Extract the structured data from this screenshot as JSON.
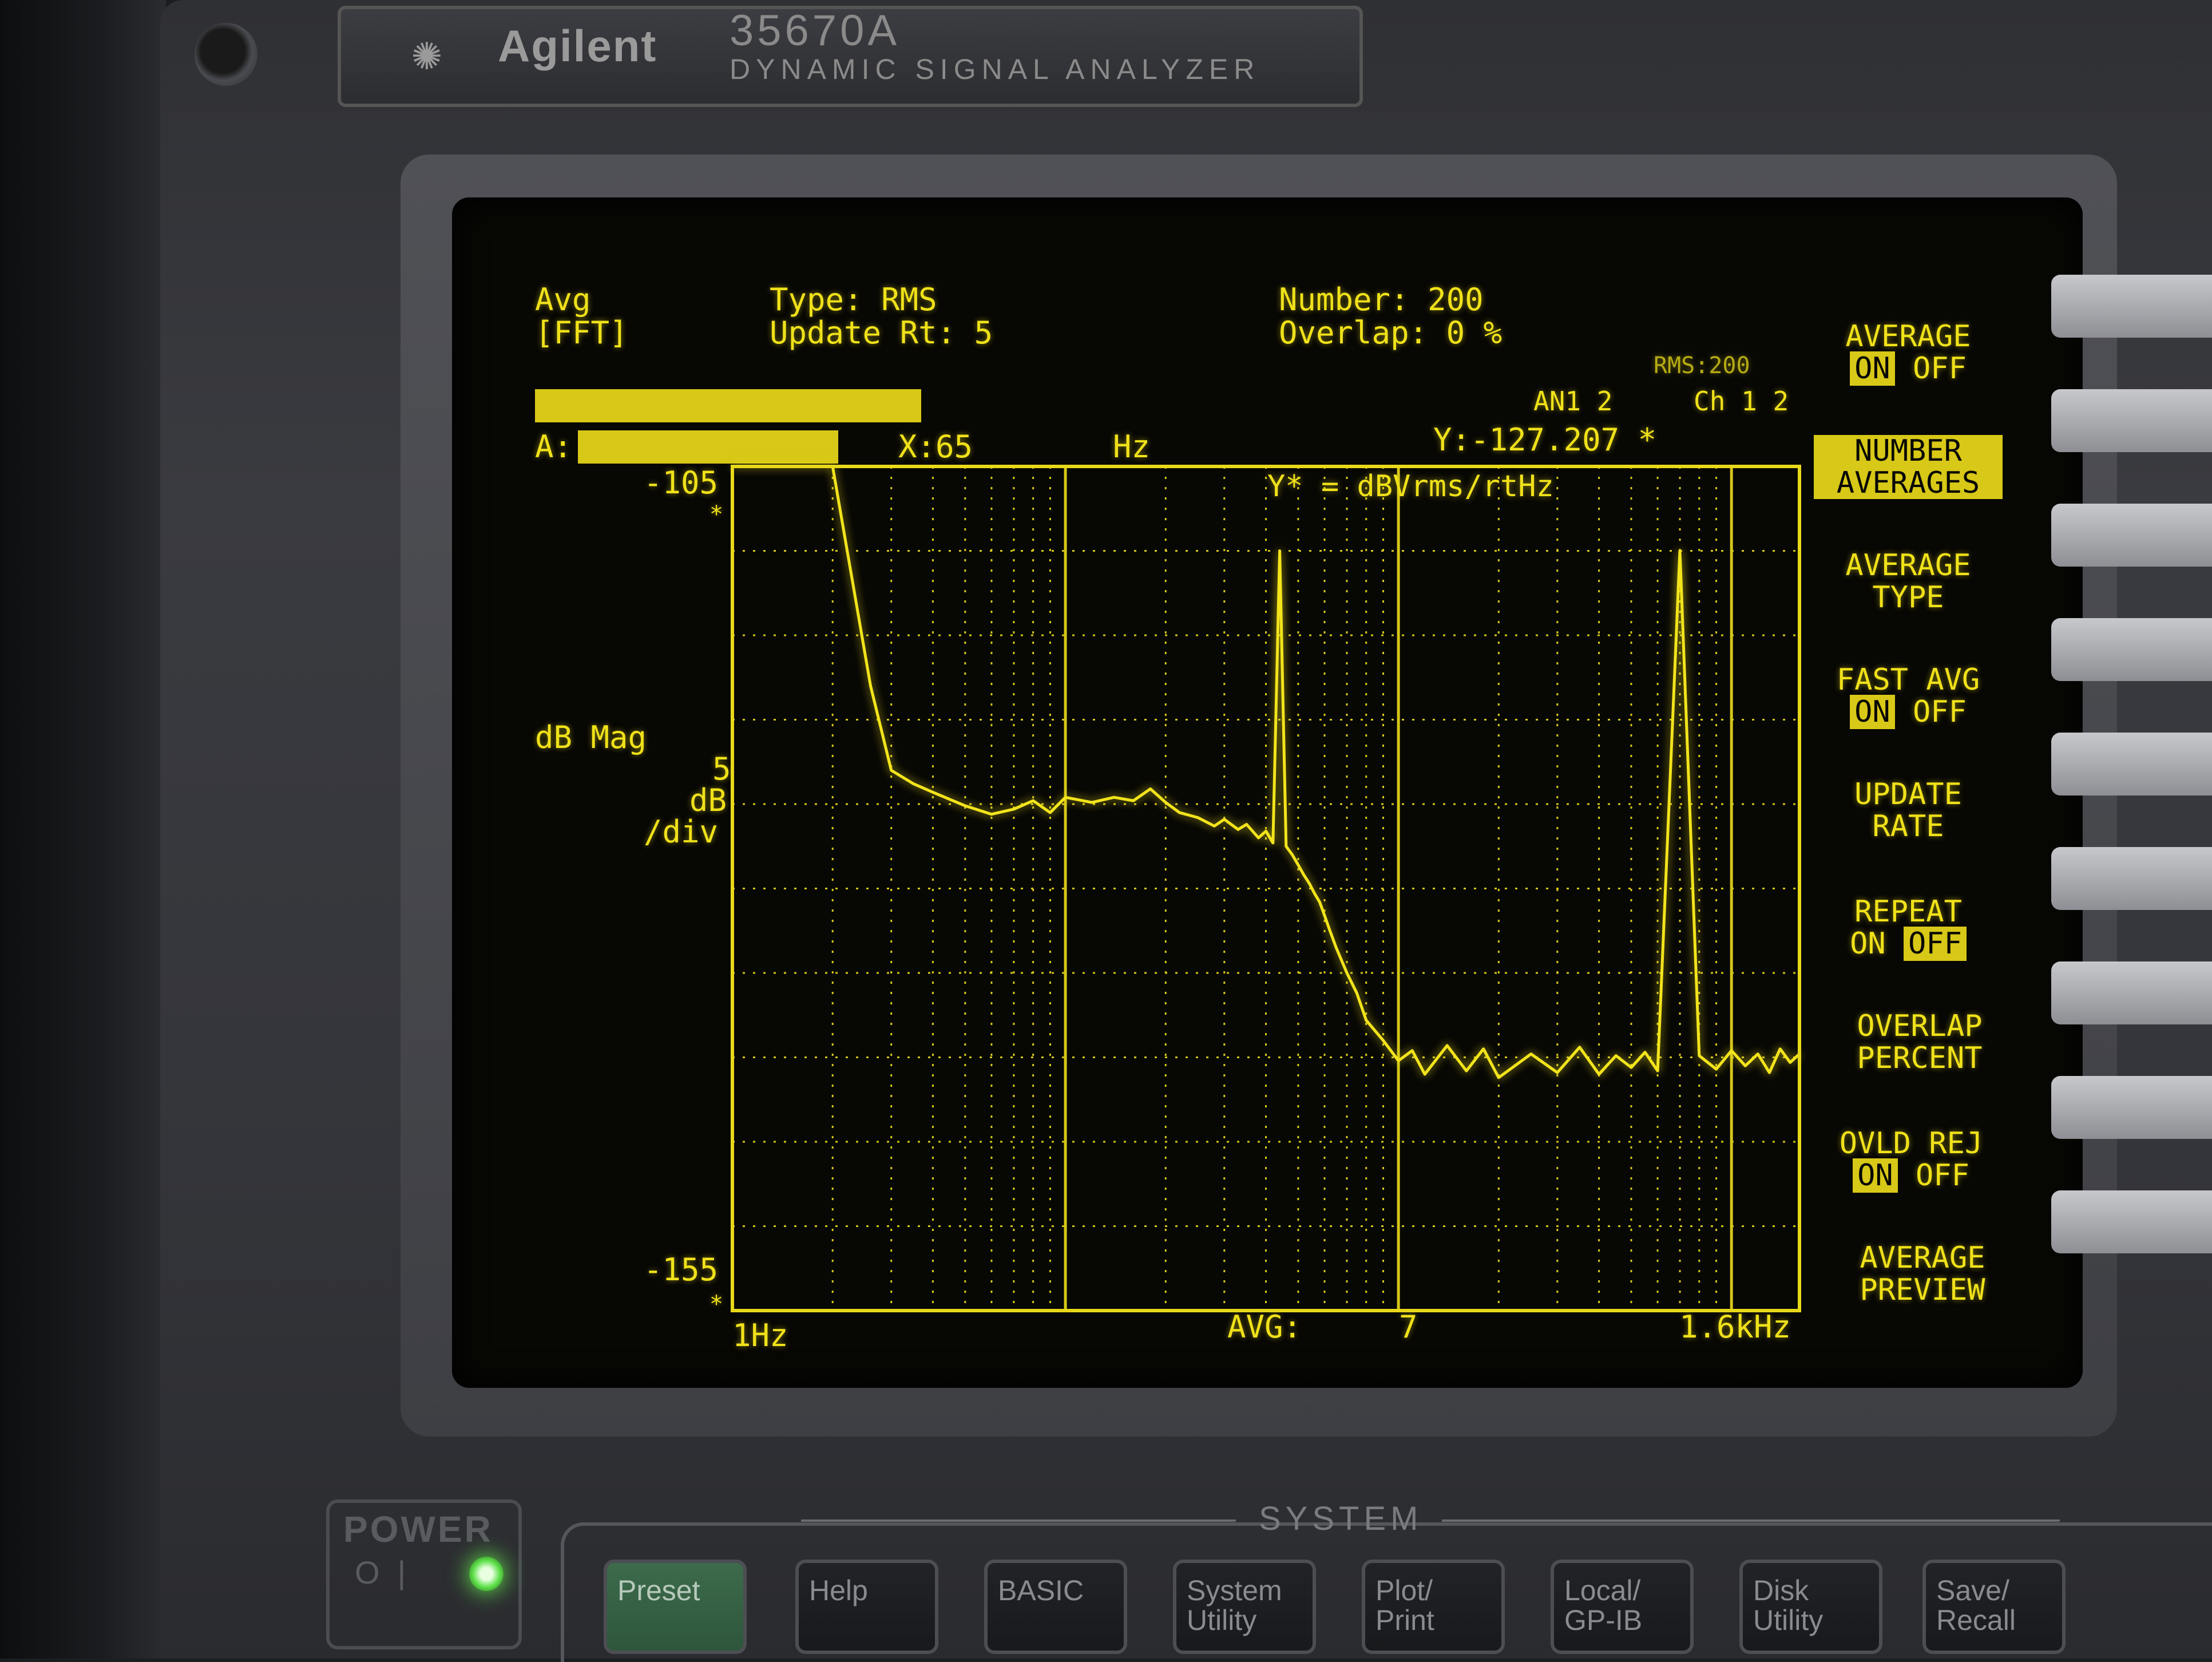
{
  "instrument": {
    "brand": "Agilent",
    "model": "35670A",
    "subtitle": "DYNAMIC SIGNAL ANALYZER"
  },
  "screen": {
    "header": {
      "mode_line1": "Avg",
      "mode_line2": "[FFT]",
      "type_label": "Type: RMS",
      "update_rate_label": "Update Rt: 5",
      "number_label": "Number: 200",
      "overlap_label": "Overlap: 0 %",
      "channel_line": "RMS:200",
      "channel_info_a": "AN1 2",
      "channel_info_b": "Ch 1 2"
    },
    "trace": {
      "label": "A:",
      "marker_x_label": "X:65",
      "marker_x_unit": "Hz",
      "marker_y_label": "Y:-127.207 *",
      "y_unit_annotation": "Y* = dBVrms/rtHz",
      "y_top": "-105",
      "y_top_star": "*",
      "y_bottom": "-155",
      "y_bottom_star": "*",
      "y_scale_label": "dB Mag",
      "y_div_1": "5",
      "y_div_2": "dB",
      "y_div_3": "/div",
      "x_start": "1Hz",
      "x_end": "1.6kHz",
      "avg_label": "AVG:",
      "avg_count": "7"
    },
    "softkeys": [
      {
        "line1": "AVERAGE",
        "on": "ON",
        "off": "OFF"
      },
      {
        "line1": "NUMBER",
        "line2": "AVERAGES"
      },
      {
        "line1": "AVERAGE",
        "line2": "TYPE"
      },
      {
        "line1": "FAST AVG",
        "on": "ON",
        "off": "OFF"
      },
      {
        "line1": "UPDATE",
        "line2": "RATE"
      },
      {
        "line1": "REPEAT",
        "on": "ON",
        "off": "OFF"
      },
      {
        "line1": "OVERLAP",
        "line2": "PERCENT"
      },
      {
        "line1": "OVLD REJ",
        "on": "ON",
        "off": "OFF"
      },
      {
        "line1": "AVERAGE",
        "line2": "PREVIEW"
      }
    ]
  },
  "chart_data": {
    "type": "line",
    "x_scale": "log",
    "xlim": [
      1,
      1600
    ],
    "ylim": [
      -155,
      -105
    ],
    "ylabel": "dB Mag",
    "grid": true,
    "series": [
      {
        "x": [
          1,
          1.5,
          2,
          2.6,
          3,
          3.5,
          4,
          5,
          6,
          7,
          8,
          9,
          10,
          12,
          14,
          16,
          18,
          20,
          22,
          25,
          28,
          30,
          33,
          35,
          38,
          40,
          42,
          44,
          46,
          48,
          50,
          52,
          54,
          56,
          58,
          60,
          62,
          65,
          70,
          75,
          80,
          90,
          100,
          110,
          120,
          140,
          160,
          180,
          200,
          250,
          300,
          350,
          400,
          450,
          500,
          550,
          600,
          700,
          800,
          900,
          1000,
          1100,
          1200,
          1300,
          1400,
          1500,
          1600
        ],
        "y": [
          -105,
          -105,
          -105,
          -118,
          -123,
          -123.8,
          -124.3,
          -125.1,
          -125.6,
          -125.3,
          -124.8,
          -125.5,
          -124.6,
          -124.9,
          -124.6,
          -124.8,
          -124.1,
          -124.9,
          -125.5,
          -125.8,
          -126.3,
          -125.9,
          -126.5,
          -126.2,
          -127.0,
          -126.6,
          -127.3,
          -110,
          -127.5,
          -128.0,
          -128.6,
          -129.2,
          -129.7,
          -130.3,
          -130.8,
          -131.6,
          -132.4,
          -133.5,
          -135.0,
          -136.2,
          -137.8,
          -139.0,
          -140.2,
          -139.6,
          -141.0,
          -139.3,
          -140.8,
          -139.5,
          -141.2,
          -139.8,
          -140.9,
          -139.4,
          -141.0,
          -139.9,
          -140.6,
          -139.7,
          -140.8,
          -110,
          -139.9,
          -140.7,
          -139.6,
          -140.5,
          -139.8,
          -140.9,
          -139.5,
          -140.3,
          -139.8
        ]
      }
    ]
  }
}
